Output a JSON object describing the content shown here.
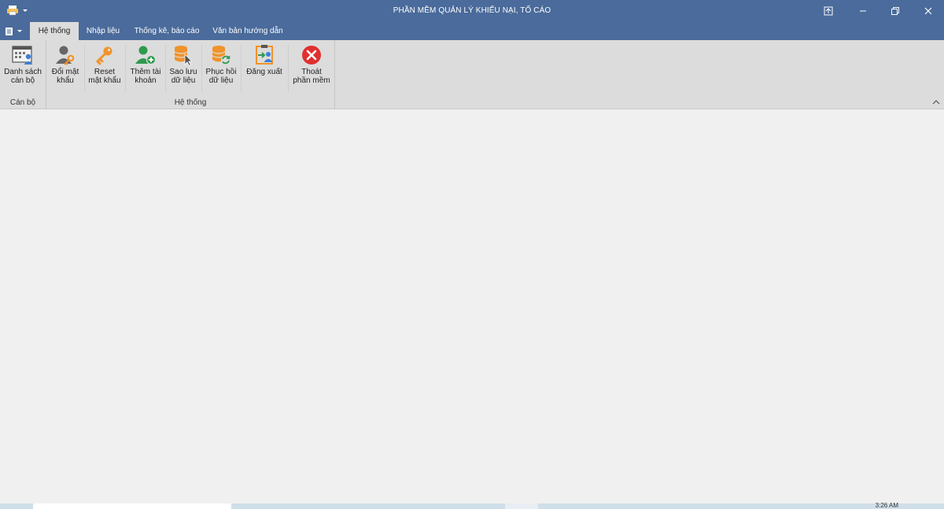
{
  "window": {
    "title": "PHẦN MỀM QUẢN LÝ KHIẾU NẠI, TỐ CÁO"
  },
  "tabs": [
    {
      "label": "Hệ thống",
      "active": true
    },
    {
      "label": "Nhập liệu",
      "active": false
    },
    {
      "label": "Thống kê, báo cáo",
      "active": false
    },
    {
      "label": "Văn bản hướng dẫn",
      "active": false
    }
  ],
  "ribbon": {
    "groups": [
      {
        "label": "Cán bộ"
      },
      {
        "label": "Hệ thống"
      }
    ],
    "buttons": {
      "danh_sach_can_bo": "Danh sách\ncán bộ",
      "doi_mat_khau": "Đổi mật\nkhẩu",
      "reset_mat_khau": "Reset\nmật khẩu",
      "them_tai_khoan": "Thêm tài\nkhoản",
      "sao_luu": "Sao lưu\ndữ liệu",
      "phuc_hoi": "Phục hồi\ndữ liệu",
      "dang_xuat": "Đăng xuất",
      "thoat": "Thoát\nphần mềm"
    }
  },
  "icons": {
    "quick_access": "printer-icon",
    "file_menu": "document-list-icon",
    "minimize": "minimize-icon",
    "restore": "restore-icon",
    "close": "close-icon",
    "ribbon_options": "ribbon-display-options-icon"
  },
  "colors": {
    "titlebar": "#4a6b9b",
    "ribbon": "#dcdcdc",
    "workspace": "#f0f0f0",
    "accent_orange": "#f0932b",
    "accent_green": "#2e9a4e",
    "accent_red": "#e0302f"
  },
  "taskbar": {
    "clock": "3:26 AM"
  }
}
